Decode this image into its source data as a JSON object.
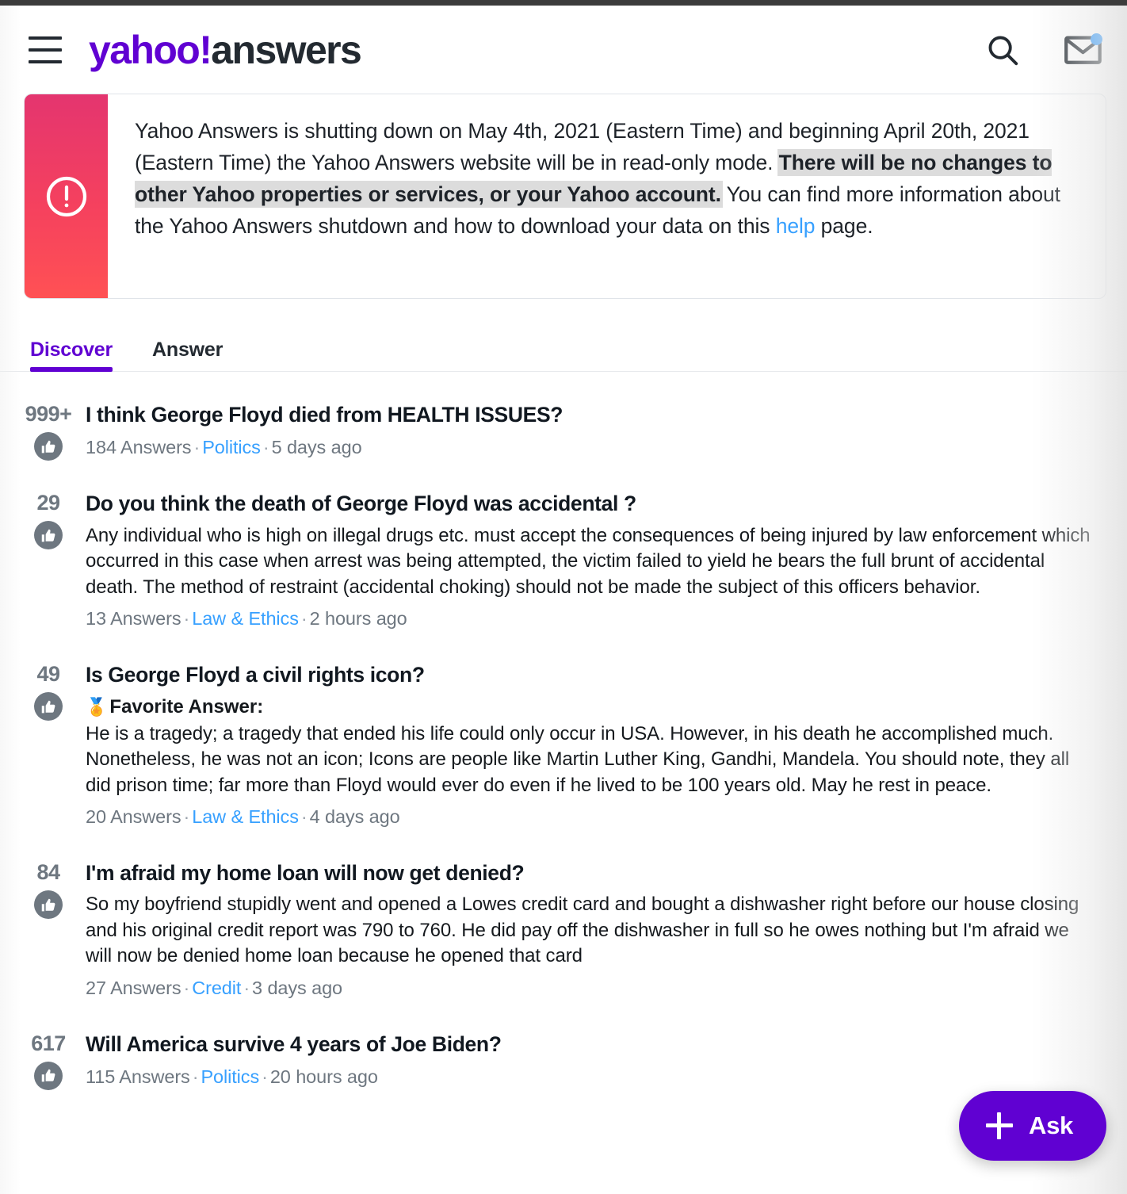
{
  "header": {
    "menu_icon": "hamburger-menu-icon",
    "brand_primary": "yahoo!",
    "brand_secondary": "answers",
    "search_icon": "search-icon",
    "mail_icon": "mail-envelope-icon",
    "accent_purple": "#6001d2",
    "notification_dot_color": "#188fff"
  },
  "alert": {
    "icon": "exclamation-circle-icon",
    "text_part1": "Yahoo Answers is shutting down on May 4th, 2021 (Eastern Time) and beginning April 20th, 2021 (Eastern Time) the Yahoo Answers website will be in read-only mode. ",
    "text_bold": "There will be no changes to other Yahoo properties or services, or your Yahoo account.",
    "text_part2": " You can find more information about the Yahoo Answers shutdown and how to download your data on this ",
    "link_label": "help",
    "text_part3": " page.",
    "gradient_start": "#e4356f",
    "gradient_end": "#ff5154",
    "link_color": "#37a0ff"
  },
  "tabs": [
    {
      "label": "Discover",
      "active": true
    },
    {
      "label": "Answer",
      "active": false
    }
  ],
  "questions": [
    {
      "votes": "999+",
      "title": "I think George Floyd died from HEALTH ISSUES?",
      "favorite_label": "",
      "snippet": "",
      "answers": "184 Answers",
      "category": "Politics",
      "time": "5 days ago"
    },
    {
      "votes": "29",
      "title": "Do you think the death of George Floyd was accidental ?",
      "favorite_label": "",
      "snippet": "Any individual who is high on illegal drugs etc. must accept the consequences of being injured by law enforcement which occurred in this case when arrest was being attempted, the victim failed to yield he bears the full brunt of accidental death. The method of restraint (accidental choking) should not be made the subject of this officers behavior.",
      "answers": "13 Answers",
      "category": "Law & Ethics",
      "time": "2 hours ago"
    },
    {
      "votes": "49",
      "title": "Is George Floyd a civil rights icon?",
      "favorite_label": "Favorite Answer:",
      "favorite_icon": "gold-medal-icon",
      "snippet": "He is a tragedy; a tragedy that ended his life could only occur in USA. However, in his death he accomplished much. Nonetheless, he was not an icon; Icons are people like Martin Luther King, Gandhi, Mandela. You should note, they all did prison time; far more than Floyd would ever do even if he lived to be 100 years old. May he rest in peace.",
      "answers": "20 Answers",
      "category": "Law & Ethics",
      "time": "4 days ago"
    },
    {
      "votes": "84",
      "title": "I'm afraid my home loan will now get denied?",
      "favorite_label": "",
      "snippet": "So my boyfriend stupidly went and opened a Lowes credit card and bought a dishwasher right before our house closing and his original credit report was 790 to 760. He did pay off the dishwasher in full so he owes nothing but I'm afraid we will now be denied home loan because he opened that card",
      "answers": "27 Answers",
      "category": "Credit",
      "time": "3 days ago"
    },
    {
      "votes": "617",
      "title": "Will America survive 4 years of Joe Biden?",
      "favorite_label": "",
      "snippet": "",
      "answers": "115 Answers",
      "category": "Politics",
      "time": "20 hours ago"
    }
  ],
  "ask_button": {
    "label": "Ask",
    "icon": "plus-icon",
    "color": "#6001d2"
  },
  "separator": "·"
}
